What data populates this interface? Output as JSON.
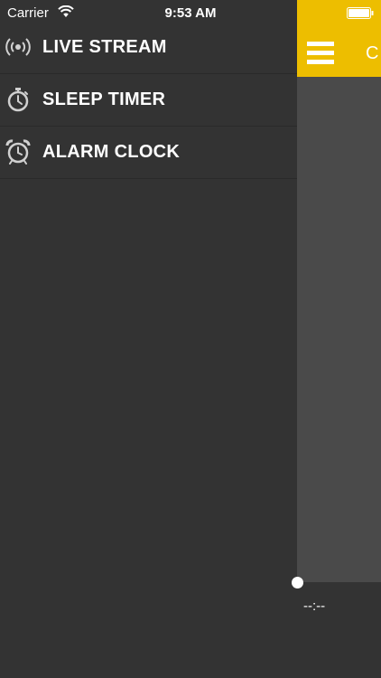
{
  "status_bar": {
    "carrier": "Carrier",
    "time": "9:53 AM"
  },
  "menu": {
    "items": [
      {
        "label": "LIVE STREAM",
        "icon": "live-stream-icon"
      },
      {
        "label": "SLEEP TIMER",
        "icon": "stopwatch-icon"
      },
      {
        "label": "ALARM CLOCK",
        "icon": "alarm-clock-icon"
      }
    ]
  },
  "content": {
    "header_title": "C",
    "header_color": "#edbe00",
    "time_readout": "--:--"
  },
  "colors": {
    "drawer_bg": "#333333",
    "panel_bg": "#4a4a4a",
    "accent": "#edbe00",
    "text": "#ffffff",
    "icon": "#d0d0d0"
  }
}
